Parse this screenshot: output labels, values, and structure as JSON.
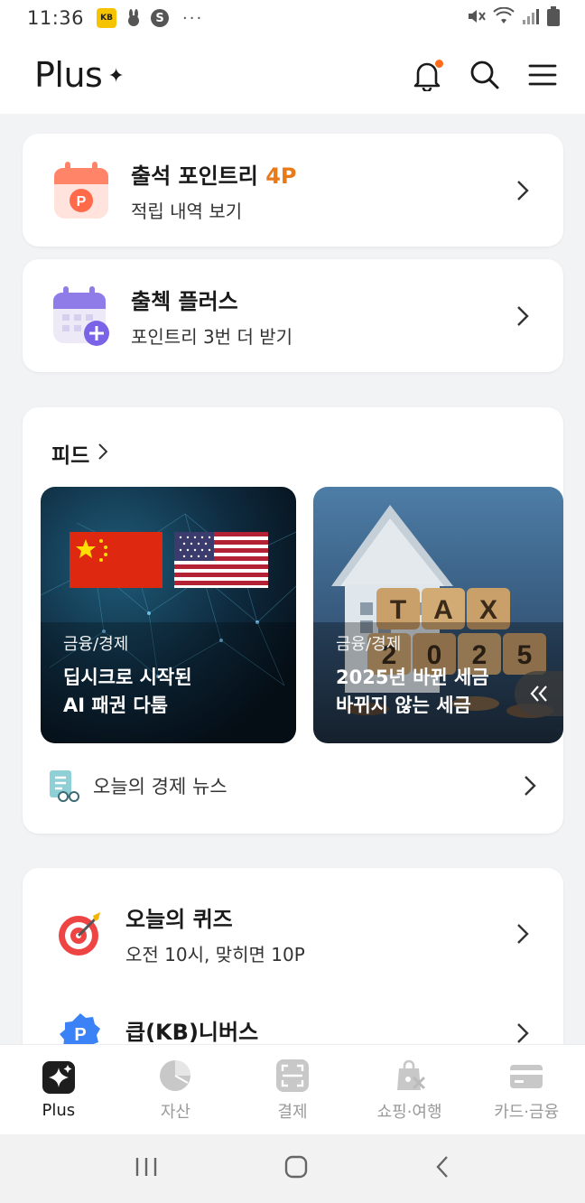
{
  "status_bar": {
    "time": "11:36",
    "more": "···"
  },
  "header": {
    "brand": "Plus",
    "brand_mark": "✦"
  },
  "attendance_card": {
    "title": "출석 포인트리 ",
    "title_accent": "4P",
    "subtitle": "적립 내역 보기"
  },
  "check_plus_card": {
    "title": "출첵 플러스",
    "subtitle": "포인트리 3번 더 받기"
  },
  "feed": {
    "heading": "피드",
    "items": [
      {
        "category": "금융/경제",
        "title_line1": "딥시크로 시작된",
        "title_line2": "AI 패권 다툼"
      },
      {
        "category": "금융/경제",
        "title_line1": "2025년 바뀐 세금",
        "title_line2": "바뀌지 않는 세금"
      }
    ],
    "news_link": "오늘의 경제 뉴스"
  },
  "quiz_list": [
    {
      "title": "오늘의 퀴즈",
      "subtitle": "오전 10시, 맞히면 10P"
    },
    {
      "title": "큽(KB)니버스",
      "subtitle": ""
    }
  ],
  "bottom_nav": [
    {
      "label": "Plus",
      "icon": "plus-sparkle-icon",
      "active": true
    },
    {
      "label": "자산",
      "icon": "pie-chart-icon"
    },
    {
      "label": "결제",
      "icon": "scan-pay-icon"
    },
    {
      "label": "쇼핑·여행",
      "icon": "shopping-bag-icon"
    },
    {
      "label": "카드·금융",
      "icon": "card-icon"
    }
  ],
  "colors": {
    "accent": "#e97a1a",
    "notification": "#ff6b1a",
    "background": "#f2f3f5"
  }
}
